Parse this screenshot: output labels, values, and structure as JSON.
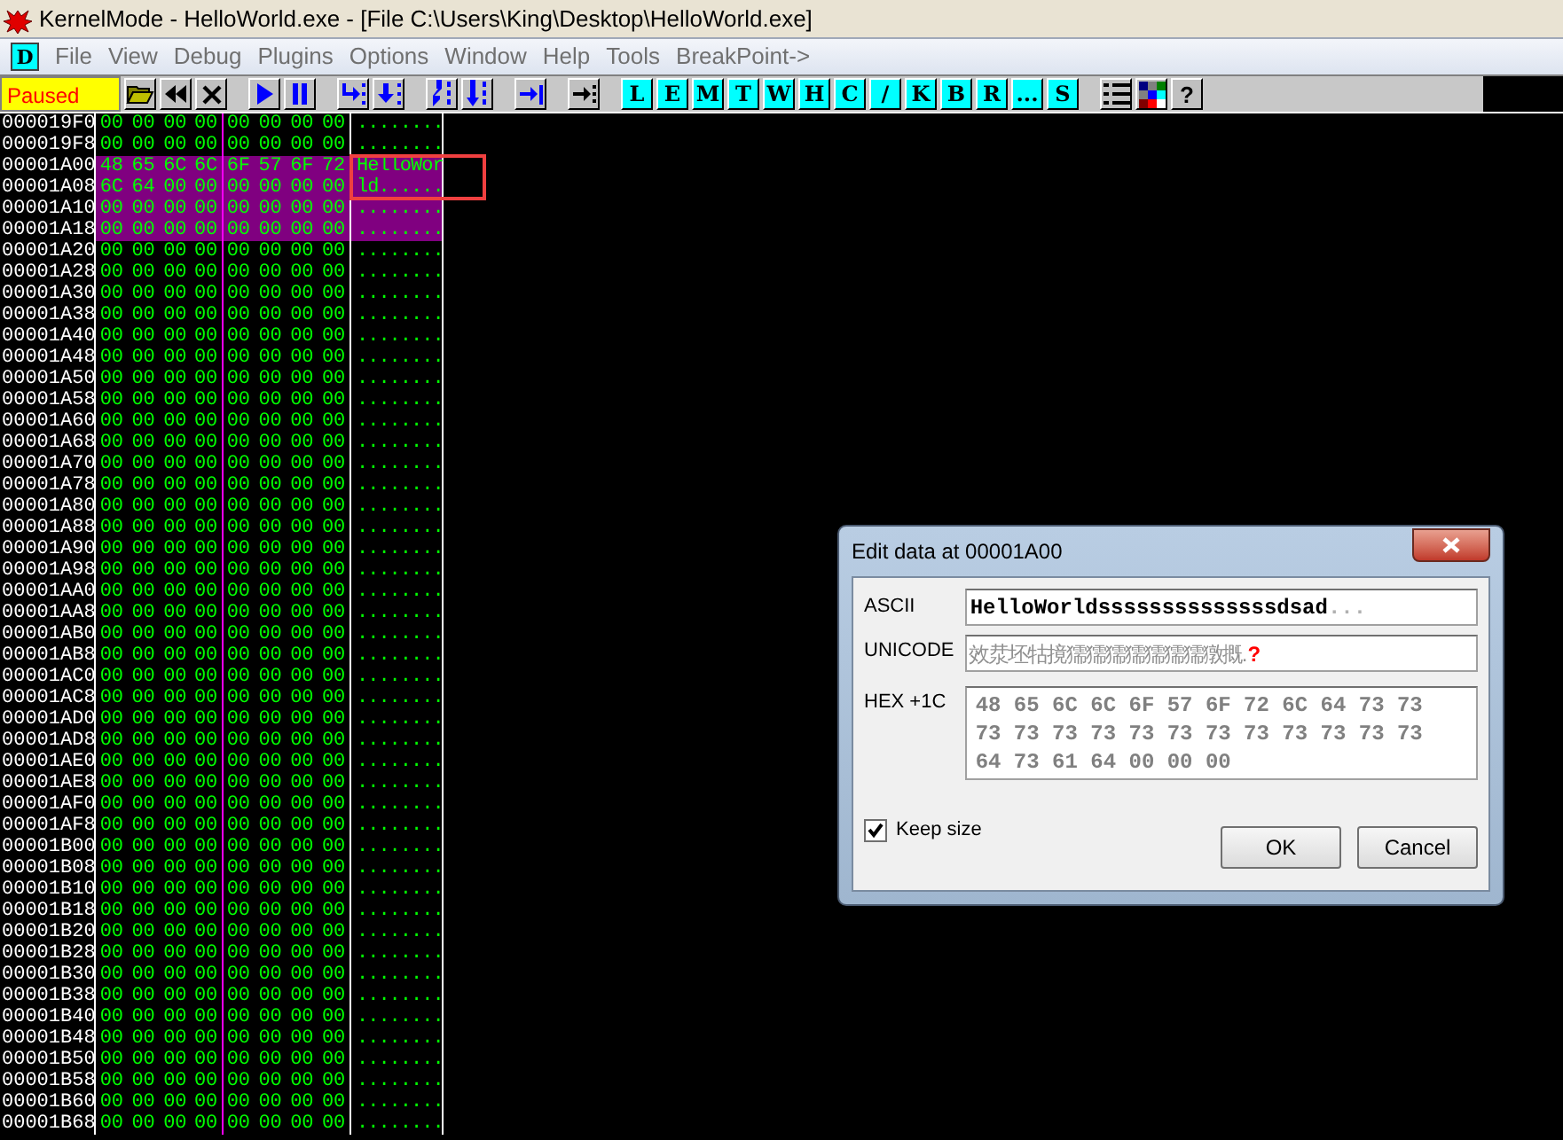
{
  "window": {
    "title": "KernelMode - HelloWorld.exe - [File C:\\Users\\King\\Desktop\\HelloWorld.exe]"
  },
  "menu": {
    "badge": "D",
    "items": [
      "File",
      "View",
      "Debug",
      "Plugins",
      "Options",
      "Window",
      "Help",
      "Tools",
      "BreakPoint->"
    ]
  },
  "toolbar": {
    "status": "Paused",
    "groups": [
      [
        {
          "kind": "open"
        },
        {
          "kind": "rewind"
        },
        {
          "kind": "close"
        }
      ],
      [
        {
          "kind": "run"
        },
        {
          "kind": "pause"
        }
      ],
      [
        {
          "kind": "step-into"
        },
        {
          "kind": "step-over"
        }
      ],
      [
        {
          "kind": "trace-into"
        },
        {
          "kind": "trace-over"
        }
      ],
      [
        {
          "kind": "till-return"
        }
      ],
      [
        {
          "kind": "goto"
        }
      ],
      [
        {
          "kind": "letter",
          "label": "L"
        },
        {
          "kind": "letter",
          "label": "E"
        },
        {
          "kind": "letter",
          "label": "M"
        },
        {
          "kind": "letter",
          "label": "T"
        },
        {
          "kind": "letter",
          "label": "W"
        },
        {
          "kind": "letter",
          "label": "H"
        },
        {
          "kind": "letter",
          "label": "C"
        },
        {
          "kind": "letter",
          "label": "/"
        },
        {
          "kind": "letter",
          "label": "K"
        },
        {
          "kind": "letter",
          "label": "B"
        },
        {
          "kind": "letter",
          "label": "R"
        },
        {
          "kind": "letter",
          "label": "..."
        },
        {
          "kind": "letter",
          "label": "S"
        }
      ],
      [
        {
          "kind": "list"
        },
        {
          "kind": "colors"
        },
        {
          "kind": "text",
          "label": "?"
        }
      ]
    ]
  },
  "dump": {
    "rows": [
      {
        "address": "000019F0",
        "bytes": [
          "00",
          "00",
          "00",
          "00",
          "00",
          "00",
          "00",
          "00"
        ],
        "ascii": "........",
        "selected": false
      },
      {
        "address": "000019F8",
        "bytes": [
          "00",
          "00",
          "00",
          "00",
          "00",
          "00",
          "00",
          "00"
        ],
        "ascii": "........",
        "selected": false
      },
      {
        "address": "00001A00",
        "bytes": [
          "48",
          "65",
          "6C",
          "6C",
          "6F",
          "57",
          "6F",
          "72"
        ],
        "ascii": "HelloWor",
        "selected": true
      },
      {
        "address": "00001A08",
        "bytes": [
          "6C",
          "64",
          "00",
          "00",
          "00",
          "00",
          "00",
          "00"
        ],
        "ascii": "ld......",
        "selected": true
      },
      {
        "address": "00001A10",
        "bytes": [
          "00",
          "00",
          "00",
          "00",
          "00",
          "00",
          "00",
          "00"
        ],
        "ascii": "........",
        "selected": true
      },
      {
        "address": "00001A18",
        "bytes": [
          "00",
          "00",
          "00",
          "00",
          "00",
          "00",
          "00",
          "00"
        ],
        "ascii": "........",
        "selected": true
      },
      {
        "address": "00001A20",
        "bytes": [
          "00",
          "00",
          "00",
          "00",
          "00",
          "00",
          "00",
          "00"
        ],
        "ascii": "........",
        "selected": false
      },
      {
        "address": "00001A28",
        "bytes": [
          "00",
          "00",
          "00",
          "00",
          "00",
          "00",
          "00",
          "00"
        ],
        "ascii": "........",
        "selected": false
      },
      {
        "address": "00001A30",
        "bytes": [
          "00",
          "00",
          "00",
          "00",
          "00",
          "00",
          "00",
          "00"
        ],
        "ascii": "........",
        "selected": false
      },
      {
        "address": "00001A38",
        "bytes": [
          "00",
          "00",
          "00",
          "00",
          "00",
          "00",
          "00",
          "00"
        ],
        "ascii": "........",
        "selected": false
      },
      {
        "address": "00001A40",
        "bytes": [
          "00",
          "00",
          "00",
          "00",
          "00",
          "00",
          "00",
          "00"
        ],
        "ascii": "........",
        "selected": false
      },
      {
        "address": "00001A48",
        "bytes": [
          "00",
          "00",
          "00",
          "00",
          "00",
          "00",
          "00",
          "00"
        ],
        "ascii": "........",
        "selected": false
      },
      {
        "address": "00001A50",
        "bytes": [
          "00",
          "00",
          "00",
          "00",
          "00",
          "00",
          "00",
          "00"
        ],
        "ascii": "........",
        "selected": false
      },
      {
        "address": "00001A58",
        "bytes": [
          "00",
          "00",
          "00",
          "00",
          "00",
          "00",
          "00",
          "00"
        ],
        "ascii": "........",
        "selected": false
      },
      {
        "address": "00001A60",
        "bytes": [
          "00",
          "00",
          "00",
          "00",
          "00",
          "00",
          "00",
          "00"
        ],
        "ascii": "........",
        "selected": false
      },
      {
        "address": "00001A68",
        "bytes": [
          "00",
          "00",
          "00",
          "00",
          "00",
          "00",
          "00",
          "00"
        ],
        "ascii": "........",
        "selected": false
      },
      {
        "address": "00001A70",
        "bytes": [
          "00",
          "00",
          "00",
          "00",
          "00",
          "00",
          "00",
          "00"
        ],
        "ascii": "........",
        "selected": false
      },
      {
        "address": "00001A78",
        "bytes": [
          "00",
          "00",
          "00",
          "00",
          "00",
          "00",
          "00",
          "00"
        ],
        "ascii": "........",
        "selected": false
      },
      {
        "address": "00001A80",
        "bytes": [
          "00",
          "00",
          "00",
          "00",
          "00",
          "00",
          "00",
          "00"
        ],
        "ascii": "........",
        "selected": false
      },
      {
        "address": "00001A88",
        "bytes": [
          "00",
          "00",
          "00",
          "00",
          "00",
          "00",
          "00",
          "00"
        ],
        "ascii": "........",
        "selected": false
      },
      {
        "address": "00001A90",
        "bytes": [
          "00",
          "00",
          "00",
          "00",
          "00",
          "00",
          "00",
          "00"
        ],
        "ascii": "........",
        "selected": false
      },
      {
        "address": "00001A98",
        "bytes": [
          "00",
          "00",
          "00",
          "00",
          "00",
          "00",
          "00",
          "00"
        ],
        "ascii": "........",
        "selected": false
      },
      {
        "address": "00001AA0",
        "bytes": [
          "00",
          "00",
          "00",
          "00",
          "00",
          "00",
          "00",
          "00"
        ],
        "ascii": "........",
        "selected": false
      },
      {
        "address": "00001AA8",
        "bytes": [
          "00",
          "00",
          "00",
          "00",
          "00",
          "00",
          "00",
          "00"
        ],
        "ascii": "........",
        "selected": false
      },
      {
        "address": "00001AB0",
        "bytes": [
          "00",
          "00",
          "00",
          "00",
          "00",
          "00",
          "00",
          "00"
        ],
        "ascii": "........",
        "selected": false
      },
      {
        "address": "00001AB8",
        "bytes": [
          "00",
          "00",
          "00",
          "00",
          "00",
          "00",
          "00",
          "00"
        ],
        "ascii": "........",
        "selected": false
      },
      {
        "address": "00001AC0",
        "bytes": [
          "00",
          "00",
          "00",
          "00",
          "00",
          "00",
          "00",
          "00"
        ],
        "ascii": "........",
        "selected": false
      },
      {
        "address": "00001AC8",
        "bytes": [
          "00",
          "00",
          "00",
          "00",
          "00",
          "00",
          "00",
          "00"
        ],
        "ascii": "........",
        "selected": false
      },
      {
        "address": "00001AD0",
        "bytes": [
          "00",
          "00",
          "00",
          "00",
          "00",
          "00",
          "00",
          "00"
        ],
        "ascii": "........",
        "selected": false
      },
      {
        "address": "00001AD8",
        "bytes": [
          "00",
          "00",
          "00",
          "00",
          "00",
          "00",
          "00",
          "00"
        ],
        "ascii": "........",
        "selected": false
      },
      {
        "address": "00001AE0",
        "bytes": [
          "00",
          "00",
          "00",
          "00",
          "00",
          "00",
          "00",
          "00"
        ],
        "ascii": "........",
        "selected": false
      },
      {
        "address": "00001AE8",
        "bytes": [
          "00",
          "00",
          "00",
          "00",
          "00",
          "00",
          "00",
          "00"
        ],
        "ascii": "........",
        "selected": false
      },
      {
        "address": "00001AF0",
        "bytes": [
          "00",
          "00",
          "00",
          "00",
          "00",
          "00",
          "00",
          "00"
        ],
        "ascii": "........",
        "selected": false
      },
      {
        "address": "00001AF8",
        "bytes": [
          "00",
          "00",
          "00",
          "00",
          "00",
          "00",
          "00",
          "00"
        ],
        "ascii": "........",
        "selected": false
      },
      {
        "address": "00001B00",
        "bytes": [
          "00",
          "00",
          "00",
          "00",
          "00",
          "00",
          "00",
          "00"
        ],
        "ascii": "........",
        "selected": false
      },
      {
        "address": "00001B08",
        "bytes": [
          "00",
          "00",
          "00",
          "00",
          "00",
          "00",
          "00",
          "00"
        ],
        "ascii": "........",
        "selected": false
      },
      {
        "address": "00001B10",
        "bytes": [
          "00",
          "00",
          "00",
          "00",
          "00",
          "00",
          "00",
          "00"
        ],
        "ascii": "........",
        "selected": false
      },
      {
        "address": "00001B18",
        "bytes": [
          "00",
          "00",
          "00",
          "00",
          "00",
          "00",
          "00",
          "00"
        ],
        "ascii": "........",
        "selected": false
      },
      {
        "address": "00001B20",
        "bytes": [
          "00",
          "00",
          "00",
          "00",
          "00",
          "00",
          "00",
          "00"
        ],
        "ascii": "........",
        "selected": false
      },
      {
        "address": "00001B28",
        "bytes": [
          "00",
          "00",
          "00",
          "00",
          "00",
          "00",
          "00",
          "00"
        ],
        "ascii": "........",
        "selected": false
      },
      {
        "address": "00001B30",
        "bytes": [
          "00",
          "00",
          "00",
          "00",
          "00",
          "00",
          "00",
          "00"
        ],
        "ascii": "........",
        "selected": false
      },
      {
        "address": "00001B38",
        "bytes": [
          "00",
          "00",
          "00",
          "00",
          "00",
          "00",
          "00",
          "00"
        ],
        "ascii": "........",
        "selected": false
      },
      {
        "address": "00001B40",
        "bytes": [
          "00",
          "00",
          "00",
          "00",
          "00",
          "00",
          "00",
          "00"
        ],
        "ascii": "........",
        "selected": false
      },
      {
        "address": "00001B48",
        "bytes": [
          "00",
          "00",
          "00",
          "00",
          "00",
          "00",
          "00",
          "00"
        ],
        "ascii": "........",
        "selected": false
      },
      {
        "address": "00001B50",
        "bytes": [
          "00",
          "00",
          "00",
          "00",
          "00",
          "00",
          "00",
          "00"
        ],
        "ascii": "........",
        "selected": false
      },
      {
        "address": "00001B58",
        "bytes": [
          "00",
          "00",
          "00",
          "00",
          "00",
          "00",
          "00",
          "00"
        ],
        "ascii": "........",
        "selected": false
      },
      {
        "address": "00001B60",
        "bytes": [
          "00",
          "00",
          "00",
          "00",
          "00",
          "00",
          "00",
          "00"
        ],
        "ascii": "........",
        "selected": false
      },
      {
        "address": "00001B68",
        "bytes": [
          "00",
          "00",
          "00",
          "00",
          "00",
          "00",
          "00",
          "00"
        ],
        "ascii": "........",
        "selected": false
      }
    ],
    "annotation": {
      "kind": "rectangle"
    }
  },
  "dialog": {
    "title": "Edit data at 00001A00",
    "ascii": {
      "label": "ASCII",
      "value": "HelloWorldssssssssssssssdsad",
      "suffix": "..."
    },
    "unicode": {
      "label": "UNICODE",
      "value": "效汬坯牯摬獳獳獳獳獳獳獳獤摡",
      "suffix": ".",
      "marker": "?"
    },
    "hex": {
      "label": "HEX +1C",
      "lines": [
        "48 65 6C 6C 6F 57 6F 72 6C 64 73 73",
        "73 73 73 73 73 73 73 73 73 73 73 73",
        "64 73 61 64 00 00 00"
      ]
    },
    "keep_size": {
      "label": "Keep size",
      "checked": true
    },
    "buttons": [
      "OK",
      "Cancel"
    ]
  }
}
